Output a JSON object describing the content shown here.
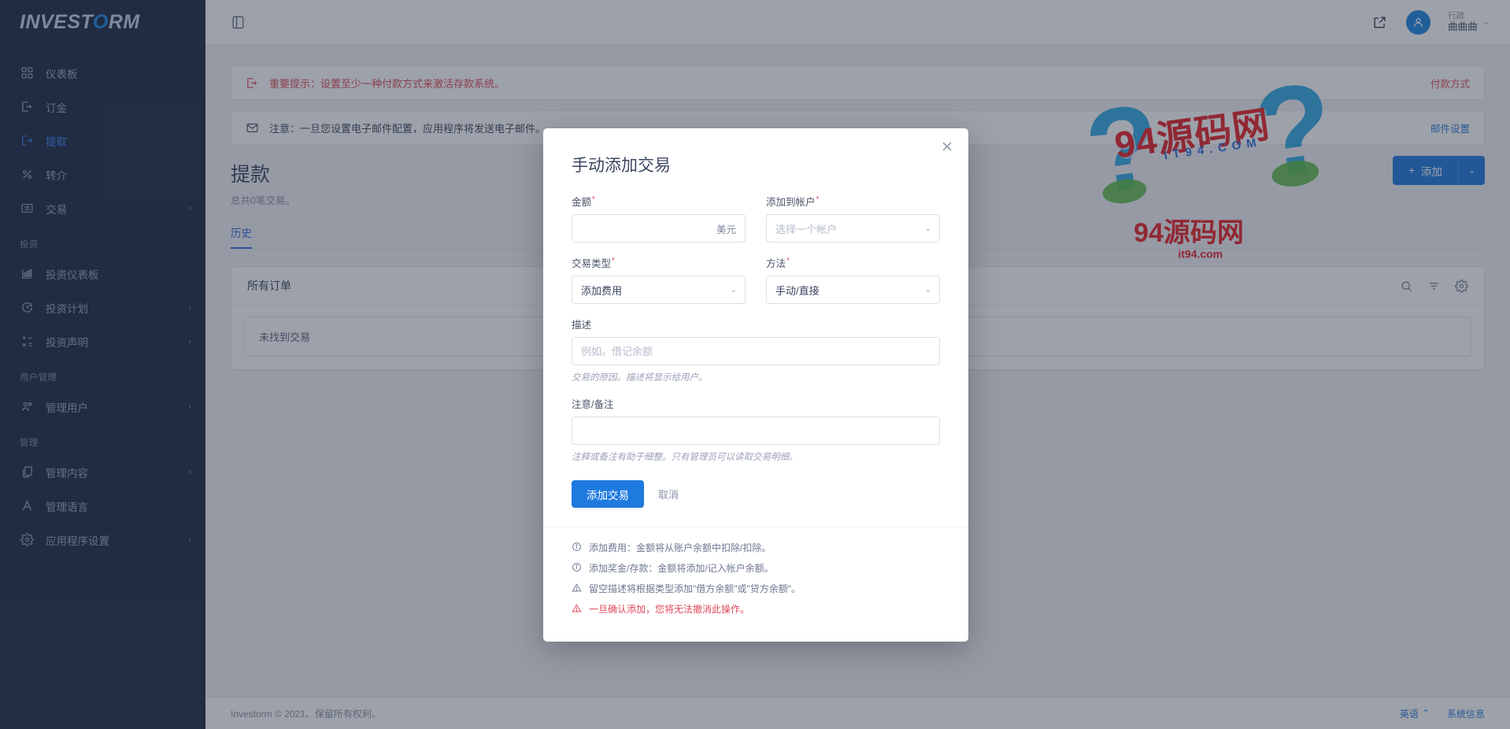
{
  "brand": {
    "part1": "INVEST",
    "accent": "O",
    "part2": "RM"
  },
  "sidebar": {
    "items": [
      {
        "label": "仪表板",
        "icon": "dashboard-icon",
        "chevron": "",
        "active": false
      },
      {
        "label": "订金",
        "icon": "deposit-icon",
        "chevron": "",
        "active": false
      },
      {
        "label": "提取",
        "icon": "withdraw-icon",
        "chevron": "",
        "active": true
      },
      {
        "label": "转介",
        "icon": "percent-icon",
        "chevron": "",
        "active": false
      },
      {
        "label": "交易",
        "icon": "exchange-icon",
        "chevron": "›",
        "active": false
      }
    ],
    "groups": [
      {
        "label": "投资",
        "items": [
          {
            "label": "投资仪表板",
            "icon": "chart-icon",
            "chevron": ""
          },
          {
            "label": "投资计划",
            "icon": "refresh-plan-icon",
            "chevron": "›"
          },
          {
            "label": "投资声明",
            "icon": "statement-icon",
            "chevron": "›"
          }
        ]
      },
      {
        "label": "用户管理",
        "items": [
          {
            "label": "管理用户",
            "icon": "users-icon",
            "chevron": "›"
          }
        ]
      },
      {
        "label": "管理",
        "items": [
          {
            "label": "管理内容",
            "icon": "content-icon",
            "chevron": "›"
          },
          {
            "label": "管理语言",
            "icon": "language-icon",
            "chevron": ""
          },
          {
            "label": "应用程序设置",
            "icon": "gear-icon",
            "chevron": "›"
          }
        ]
      }
    ]
  },
  "topbar": {
    "collapse_icon": "sidebar-toggle-icon",
    "external_icon": "external-link-icon",
    "avatar_icon": "user-avatar-icon",
    "user_role": "行政",
    "user_name": "曲曲曲",
    "caret": "⌄"
  },
  "alerts": [
    {
      "icon": "deposit-alert-icon",
      "text": "重要提示：设置至少一种付款方式来激活存款系统。",
      "link": "付款方式",
      "tone": "danger"
    },
    {
      "icon": "mail-icon",
      "text": "注意：一旦您设置电子邮件配置，应用程序将发送电子邮件。",
      "link": "邮件设置",
      "tone": "info"
    }
  ],
  "page": {
    "title": "提款",
    "subtitle": "总共0笔交易。",
    "tabs": [
      {
        "label": "历史",
        "active": true
      }
    ],
    "add_button": "添加",
    "add_button_plus": "+",
    "add_button_caret": "⌄"
  },
  "card": {
    "title": "所有订单",
    "actions": [
      {
        "icon": "search-icon"
      },
      {
        "icon": "filter-icon"
      },
      {
        "icon": "settings-icon"
      }
    ],
    "empty_text": "未找到交易"
  },
  "footer": {
    "copyright": "Investorm © 2021、保留所有权利。",
    "language": "英语",
    "language_caret": "⌃",
    "system_info": "系统信息"
  },
  "watermark": {
    "title": "94源码网",
    "subtitle": "IT94.COM",
    "flat_title": "94源码网",
    "flat_sub": "it94.com"
  },
  "modal": {
    "title": "手动添加交易",
    "close_icon": "close-icon",
    "fields": {
      "amount": {
        "label": "金额",
        "required": "*",
        "value": "",
        "placeholder": "",
        "suffix": "美元"
      },
      "account": {
        "label": "添加到帐户",
        "required": "*",
        "selected": "选择一个帐户",
        "is_placeholder": true,
        "caret": "⌄"
      },
      "txn_type": {
        "label": "交易类型",
        "required": "*",
        "selected": "添加费用",
        "caret": "⌄"
      },
      "method": {
        "label": "方法",
        "required": "*",
        "selected": "手动/直接",
        "caret": "⌄"
      },
      "description": {
        "label": "描述",
        "required": "",
        "value": "",
        "placeholder": "例如。借记余额",
        "help": "交易的原因。描述将显示给用户。"
      },
      "note": {
        "label": "注意/备注",
        "required": "",
        "value": "",
        "placeholder": "",
        "help": "注释或备注有助于细整。只有管理员可以读取交易明细。"
      }
    },
    "submit_label": "添加交易",
    "cancel_label": "取消",
    "notes": [
      {
        "icon": "info-icon",
        "text": "添加费用：金额将从账户余额中扣除/扣除。",
        "tone": "normal"
      },
      {
        "icon": "info-icon",
        "text": "添加奖金/存款：金额将添加/记入帐户余额。",
        "tone": "normal"
      },
      {
        "icon": "warning-icon",
        "text": "留空描述将根据类型添加\"借方余额\"或\"贷方余额\"。",
        "tone": "normal"
      },
      {
        "icon": "warning-icon",
        "text": "一旦确认添加，您将无法撤消此操作。",
        "tone": "warn"
      }
    ]
  },
  "colors": {
    "sidebar_bg": "#1e2a44",
    "primary": "#1f7ae0",
    "danger": "#e0485c",
    "accent_blue": "#2f6fe0"
  }
}
